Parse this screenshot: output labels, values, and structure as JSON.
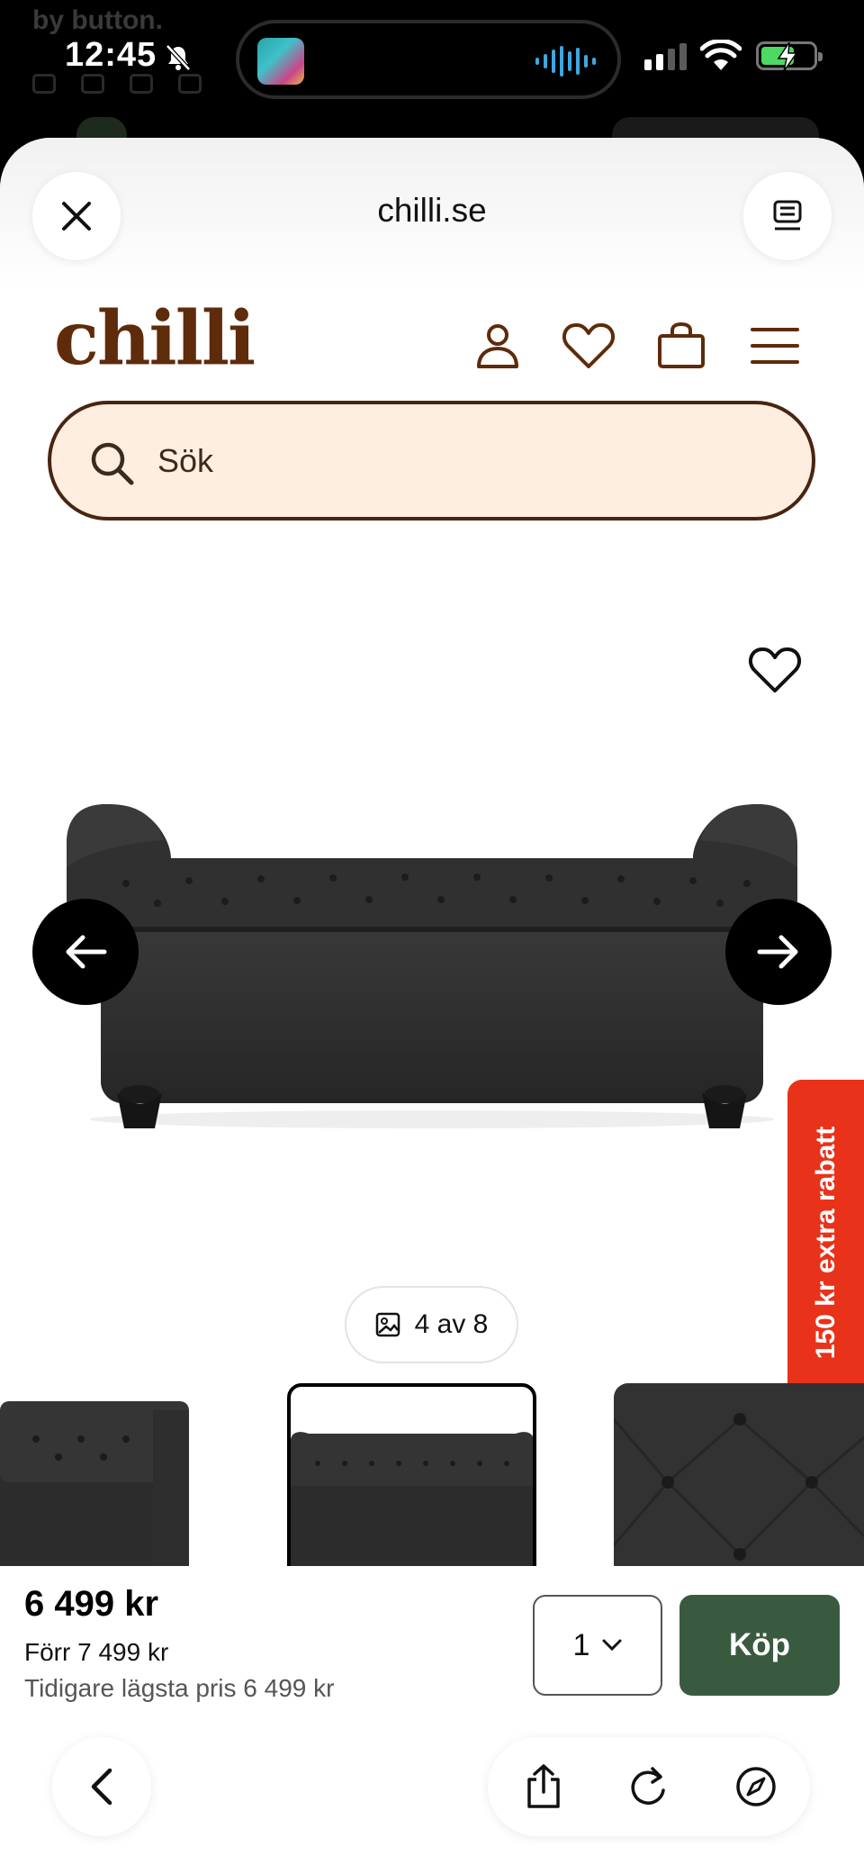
{
  "status_bar": {
    "time": "12:45",
    "ghost_text": "by button."
  },
  "browser": {
    "domain": "chilli.se"
  },
  "site": {
    "logo": "chilli",
    "search_placeholder": "Sök",
    "brand_color": "#5e2b0b",
    "search_bg": "#fdeee0"
  },
  "gallery": {
    "counter": "4 av 8",
    "promo": "150 kr extra rabatt",
    "promo_color": "#e8321a"
  },
  "purchase": {
    "price": "6 499 kr",
    "previous_price": "Förr 7 499 kr",
    "lowest_price": "Tidigare lägsta pris 6 499 kr",
    "quantity": "1",
    "buy_label": "Köp",
    "buy_color": "#3a5a40"
  }
}
